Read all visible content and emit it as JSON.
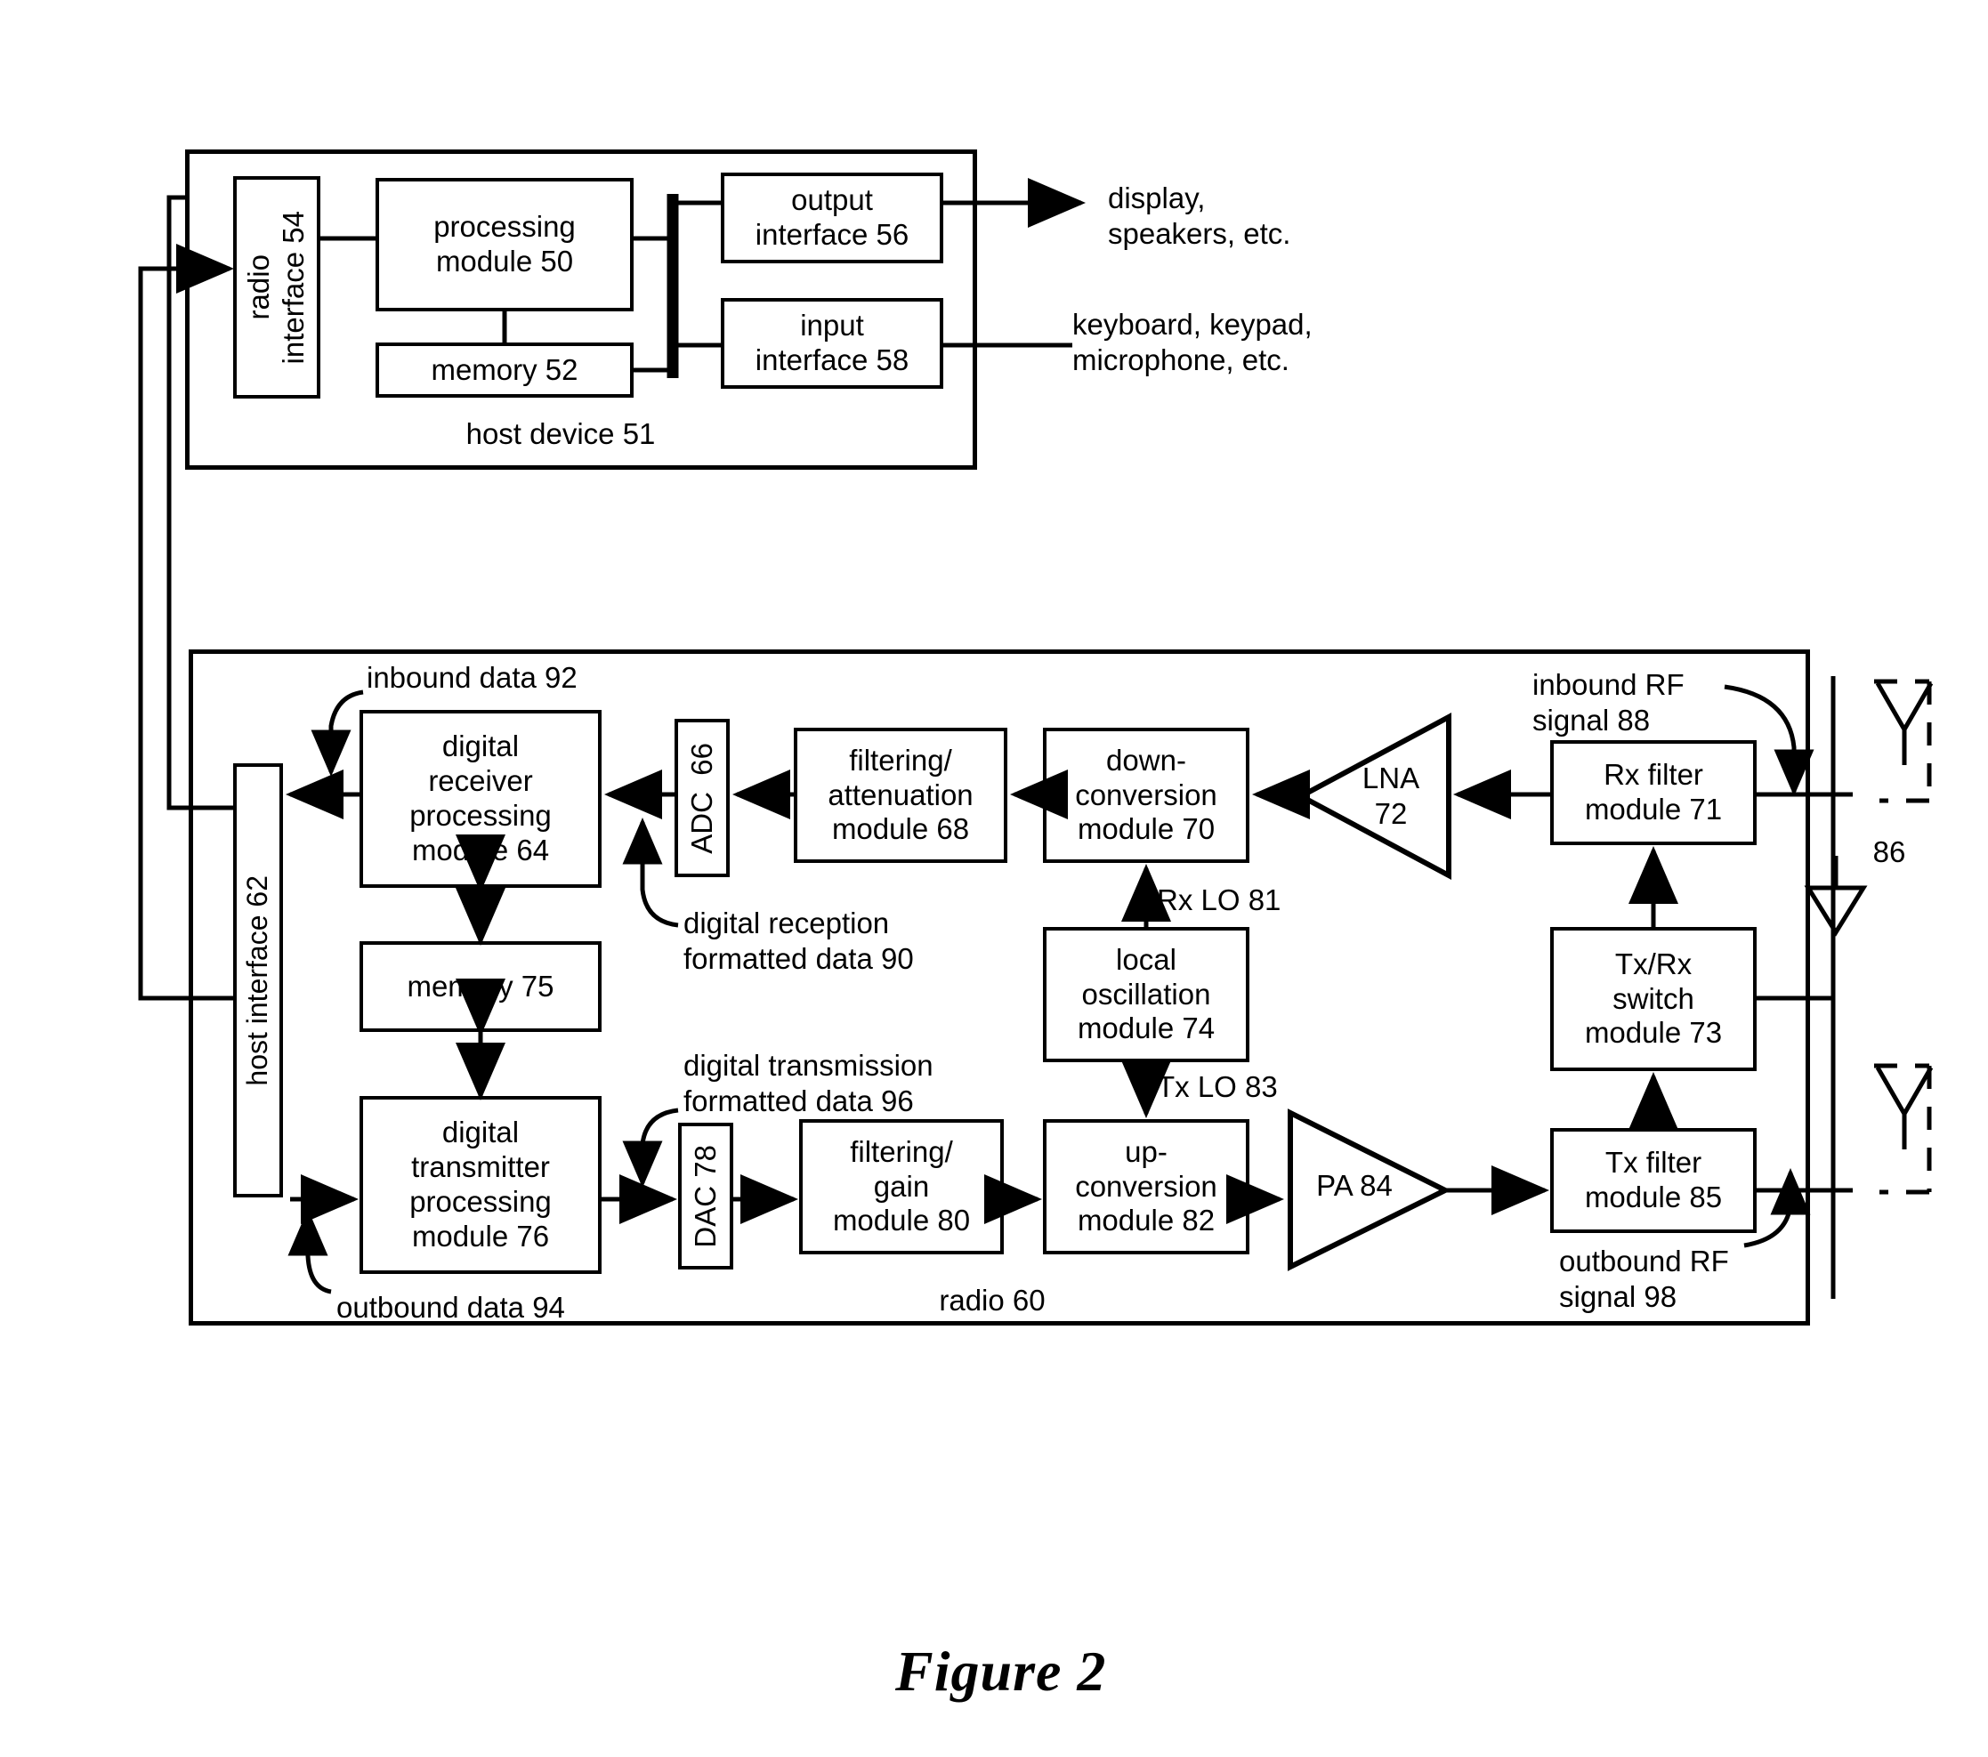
{
  "figure": {
    "caption": "Figure 2"
  },
  "host_device": {
    "label": "host device 51",
    "blocks": {
      "radio_interface": "radio\ninterface 54",
      "processing_module": "processing\nmodule 50",
      "memory": "memory 52",
      "output_interface": "output\ninterface 56",
      "input_interface": "input\ninterface 58"
    },
    "external_labels": {
      "output_devices": "display,\nspeakers, etc.",
      "input_devices": "keyboard, keypad,\nmicrophone, etc."
    }
  },
  "radio": {
    "label": "radio 60",
    "blocks": {
      "host_interface": "host interface 62",
      "digital_receiver_processing": "digital\nreceiver\nprocessing\nmodule 64",
      "adc": "ADC  66",
      "filtering_attenuation": "filtering/\nattenuation\nmodule 68",
      "down_conversion": "down-\nconversion\nmodule 70",
      "lna": "LNA\n72",
      "rx_filter": "Rx filter\nmodule 71",
      "local_oscillation": "local\noscillation\nmodule 74",
      "tx_rx_switch": "Tx/Rx\nswitch\nmodule 73",
      "memory": "memory 75",
      "digital_transmitter_processing": "digital\ntransmitter\nprocessing\nmodule 76",
      "dac": "DAC 78",
      "filtering_gain": "filtering/\ngain\nmodule 80",
      "up_conversion": "up-\nconversion\nmodule 82",
      "pa": "PA 84",
      "tx_filter": "Tx filter\nmodule 85"
    },
    "signal_labels": {
      "inbound_data": "inbound data 92",
      "digital_reception_formatted_data": "digital reception\nformatted data 90",
      "digital_transmission_formatted_data": "digital transmission\nformatted data 96",
      "outbound_data": "outbound data 94",
      "rx_lo": "Rx LO 81",
      "tx_lo": "Tx LO 83",
      "inbound_rf_signal": "inbound RF\nsignal 88",
      "outbound_rf_signal": "outbound RF\nsignal 98",
      "antenna": "86"
    }
  }
}
